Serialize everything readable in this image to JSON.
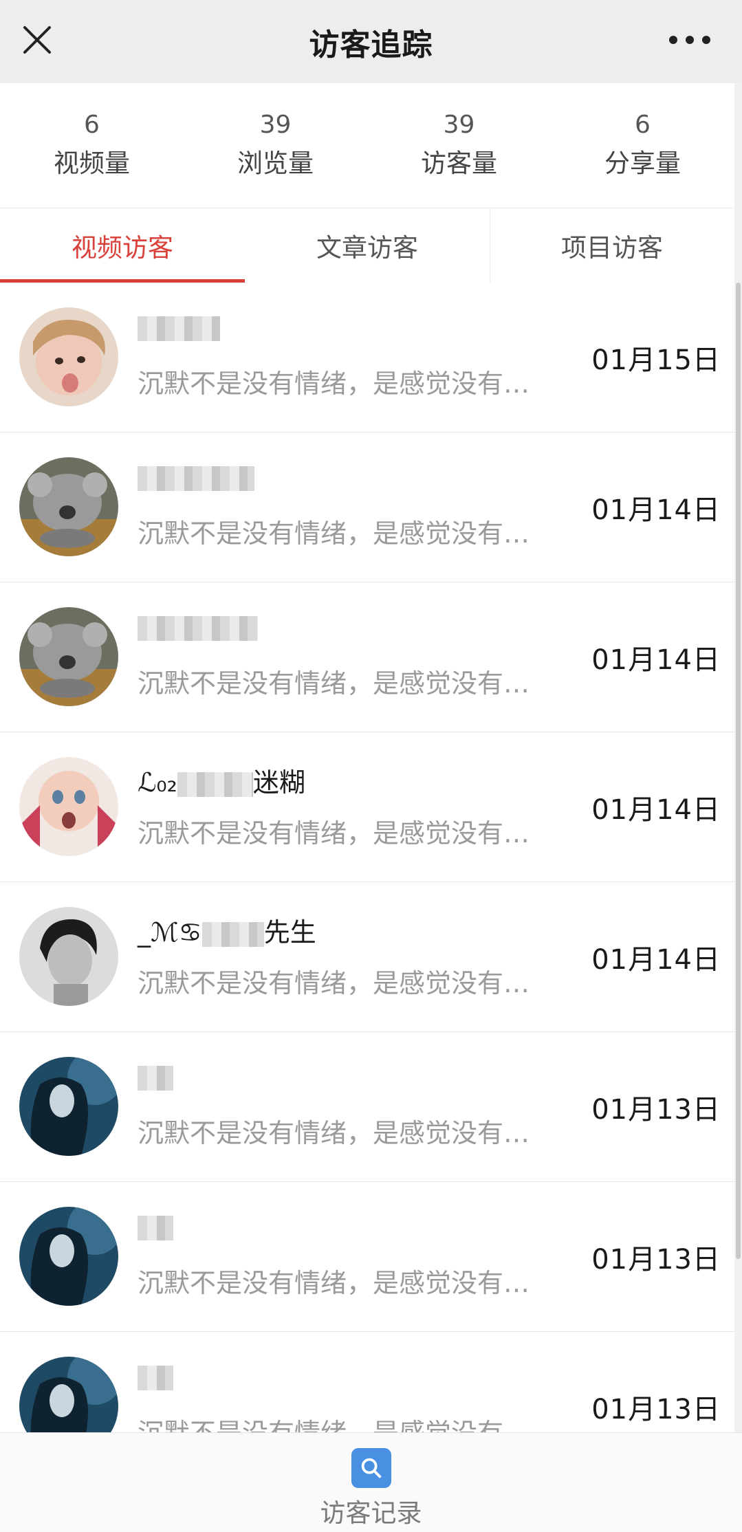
{
  "header": {
    "title": "访客追踪",
    "close_icon": "close-icon",
    "more_icon": "more-dots-icon"
  },
  "stats": [
    {
      "value": "6",
      "label": "视频量"
    },
    {
      "value": "39",
      "label": "浏览量"
    },
    {
      "value": "39",
      "label": "访客量"
    },
    {
      "value": "6",
      "label": "分享量"
    }
  ],
  "tabs": [
    {
      "label": "视频访客",
      "active": true
    },
    {
      "label": "文章访客",
      "active": false
    },
    {
      "label": "项目访客",
      "active": false
    }
  ],
  "visitors": [
    {
      "name_prefix": "",
      "name_suffix": "",
      "message": "沉默不是没有情绪，是感觉没有…",
      "date": "01月15日",
      "avatar": "child-avatar"
    },
    {
      "name_prefix": "",
      "name_suffix": "",
      "message": "沉默不是没有情绪，是感觉没有…",
      "date": "01月14日",
      "avatar": "koala-avatar"
    },
    {
      "name_prefix": "",
      "name_suffix": "",
      "message": "沉默不是没有情绪，是感觉没有…",
      "date": "01月14日",
      "avatar": "koala-avatar"
    },
    {
      "name_prefix": "ℒ₀₂",
      "name_suffix": "迷糊",
      "message": "沉默不是没有情绪，是感觉没有…",
      "date": "01月14日",
      "avatar": "baby-avatar"
    },
    {
      "name_prefix": "_ℳ♋",
      "name_suffix": "先生",
      "message": "沉默不是没有情绪，是感觉没有…",
      "date": "01月14日",
      "avatar": "man-avatar"
    },
    {
      "name_prefix": "",
      "name_suffix": "",
      "message": "沉默不是没有情绪，是感觉没有…",
      "date": "01月13日",
      "avatar": "girl-avatar"
    },
    {
      "name_prefix": "",
      "name_suffix": "",
      "message": "沉默不是没有情绪，是感觉没有…",
      "date": "01月13日",
      "avatar": "girl-avatar"
    },
    {
      "name_prefix": "",
      "name_suffix": "",
      "message": "沉默不是没有情绪，是感觉没有…",
      "date": "01月13日",
      "avatar": "girl-avatar"
    }
  ],
  "bottom_nav": {
    "label": "访客记录",
    "icon": "search-icon",
    "accent": "#4a90e2"
  },
  "colors": {
    "accent_red": "#d9413b",
    "header_bg": "#ededed"
  }
}
